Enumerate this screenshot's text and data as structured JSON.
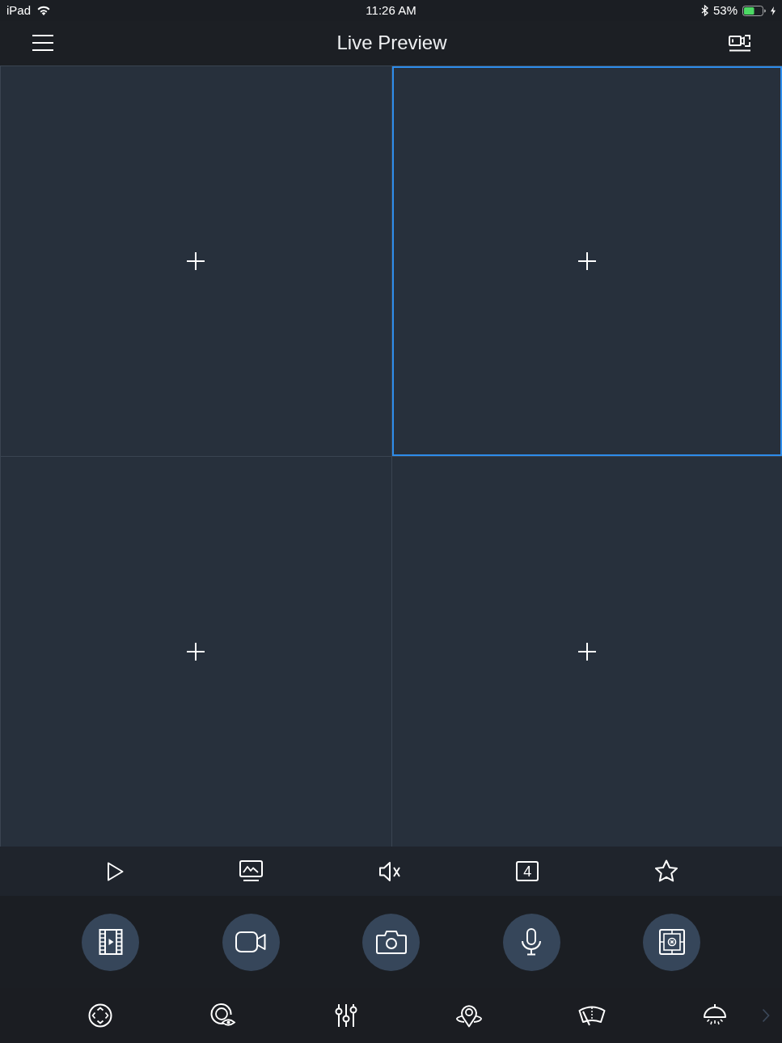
{
  "status_bar": {
    "device": "iPad",
    "time": "11:26 AM",
    "battery": "53%"
  },
  "header": {
    "title": "Live Preview"
  },
  "preview_grid": {
    "cells": [
      {
        "selected": false
      },
      {
        "selected": true
      },
      {
        "selected": false
      },
      {
        "selected": false
      }
    ]
  },
  "toolbar": {
    "split_count": "4"
  }
}
